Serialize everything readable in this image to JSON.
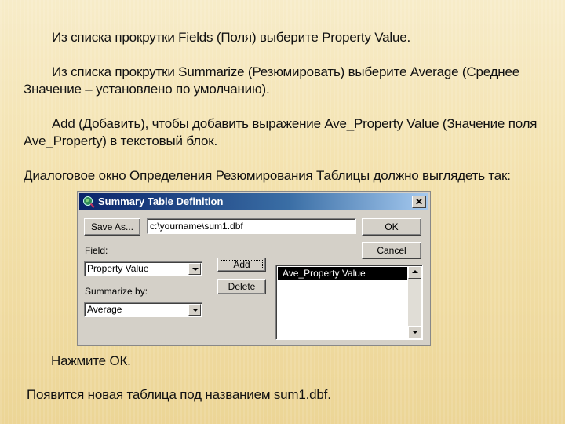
{
  "slide": {
    "paragraphs": [
      "Из списка прокрутки Fields (Поля) выберите Property Value.",
      "Из списка прокрутки Summarize (Резюмировать) выберите Average (Среднее Значение – установлено по умолчанию).",
      "Add (Добавить), чтобы добавить выражение Ave_Property Value (Значение поля Ave_Property) в текстовый блок.",
      "Диалоговое окно Определения Резюмирования Таблицы должно выглядеть так:",
      "Нажмите ОК.",
      "Появится новая таблица под названием sum1.dbf."
    ]
  },
  "dialog": {
    "title": "Summary Table Definition",
    "close_label": "✕",
    "save_as_label": "Save As...",
    "file_path": "c:\\yourname\\sum1.dbf",
    "ok_label": "OK",
    "cancel_label": "Cancel",
    "field_label": "Field:",
    "field_value": "Property Value",
    "summarize_label": "Summarize by:",
    "summarize_value": "Average",
    "add_label": "Add",
    "delete_label": "Delete",
    "list_items": [
      "Ave_Property Value"
    ]
  }
}
